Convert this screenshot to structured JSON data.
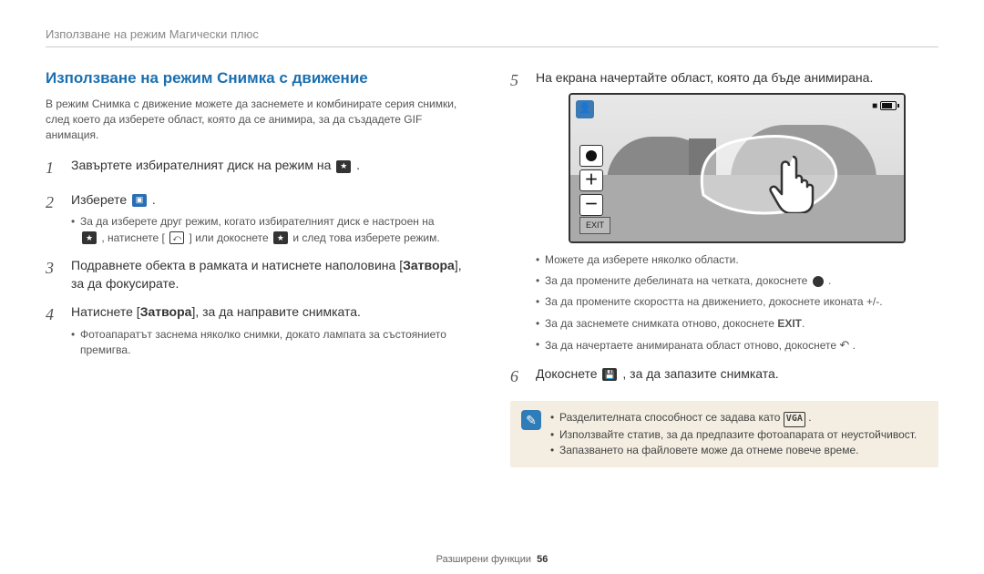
{
  "header": {
    "breadcrumb": "Използване на режим Магически плюс"
  },
  "left": {
    "title": "Използване на режим Снимка с движение",
    "intro": "В режим Снимка с движение можете да заснемете и комбинирате серия снимки, след което да изберете област, която да се анимира, за да създадете GIF анимация.",
    "steps": {
      "s1": {
        "no": "1",
        "text_a": "Завъртете избирателният диск на режим на ",
        "text_b": "."
      },
      "s2": {
        "no": "2",
        "text_a": "Изберете ",
        "text_b": ".",
        "sub_a": "За да изберете друг режим, когато избирателният диск е настроен на",
        "sub_b": ", натиснете [",
        "sub_c": "] или докоснете ",
        "sub_d": " и след това изберете режим."
      },
      "s3": {
        "no": "3",
        "text_a": "Подравнете обекта в рамката и натиснете наполовина [",
        "bold": "Затвора",
        "text_b": "], за да фокусирате."
      },
      "s4": {
        "no": "4",
        "text_a": "Натиснете [",
        "bold": "Затвора",
        "text_b": "], за да направите снимката.",
        "sub": "Фотоапаратът заснема няколко снимки, докато лампата за състоянието премигва."
      }
    }
  },
  "right": {
    "steps": {
      "s5": {
        "no": "5",
        "text": "На екрана начертайте област, която да бъде анимирана.",
        "subs": {
          "a": "Можете да изберете няколко области.",
          "b_pre": "За да промените дебелината на четката, докоснете ",
          "b_post": ".",
          "c": "За да промените скоростта на движението, докоснете иконата +/-.",
          "d_pre": "За да заснемете снимката отново, докоснете ",
          "d_bold": "EXIT",
          "d_post": ".",
          "e_pre": "За да начертаете анимираната област отново, докоснете ",
          "e_post": "."
        }
      },
      "s6": {
        "no": "6",
        "text_a": "Докоснете ",
        "text_b": ", за да запазите снимката."
      }
    },
    "screen": {
      "exit_label": "EXIT",
      "topright": "■"
    },
    "note": {
      "items": {
        "a_pre": "Разделителната способност се задава като ",
        "a_post": ".",
        "a_vga": "VGA",
        "b": "Използвайте статив, за да предпазите фотоапарата от неустойчивост.",
        "c": "Запазването на файловете може да отнеме повече време."
      }
    }
  },
  "footer": {
    "section": "Разширени функции",
    "page": "56"
  }
}
